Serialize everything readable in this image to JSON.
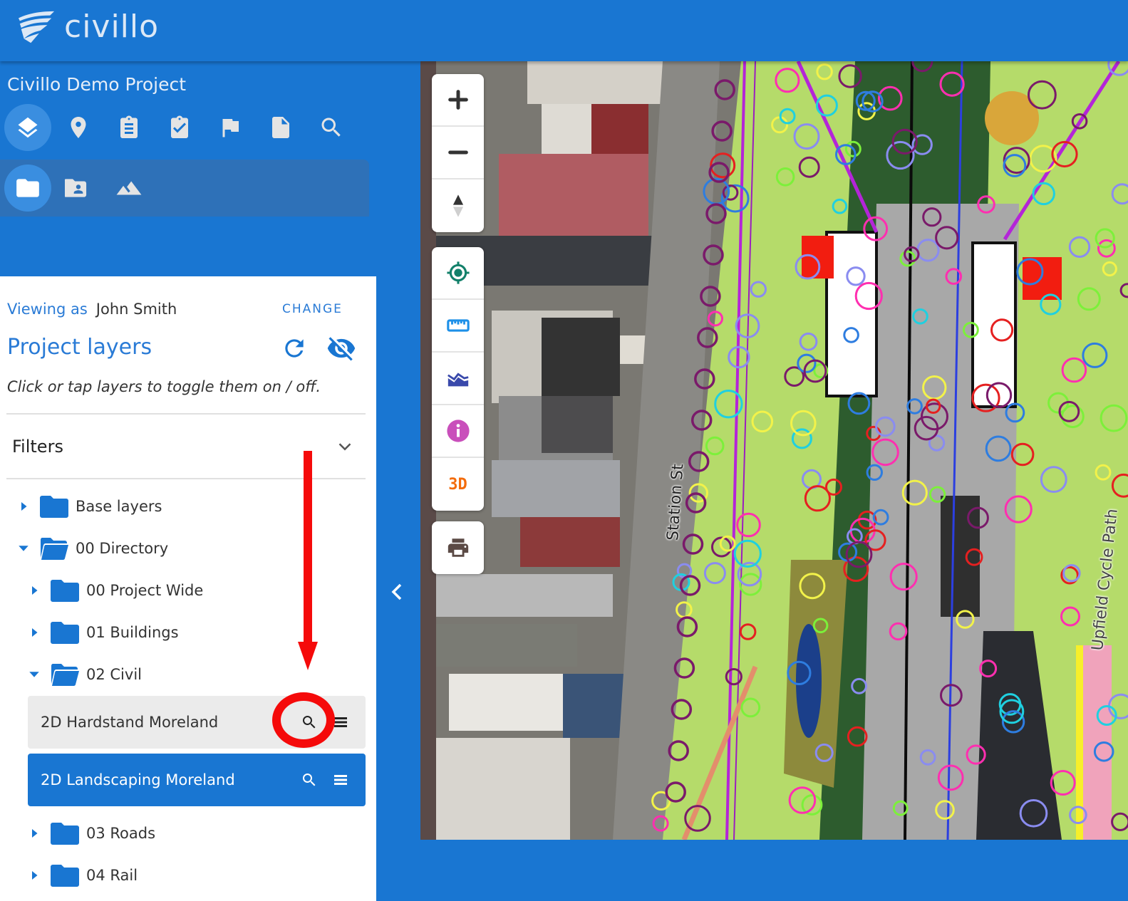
{
  "app": {
    "brand": "civillo",
    "brand_color": "#1976d2"
  },
  "sidebar": {
    "project_title": "Civillo Demo Project",
    "main_tools": [
      {
        "icon": "layers-icon",
        "label": "Layers",
        "active": true
      },
      {
        "icon": "location-pin-icon",
        "label": "Locations",
        "active": false
      },
      {
        "icon": "clipboard-list-icon",
        "label": "Forms",
        "active": false
      },
      {
        "icon": "clipboard-check-icon",
        "label": "Tasks",
        "active": false
      },
      {
        "icon": "flag-icon",
        "label": "Issues",
        "active": false
      },
      {
        "icon": "document-icon",
        "label": "Documents",
        "active": false
      },
      {
        "icon": "search-icon",
        "label": "Search",
        "active": false
      }
    ],
    "sub_tools": [
      {
        "icon": "folder-icon",
        "label": "Project layers",
        "active": true
      },
      {
        "icon": "folder-account-icon",
        "label": "User layers",
        "active": false
      },
      {
        "icon": "terrain-icon",
        "label": "Terrain",
        "active": false
      }
    ]
  },
  "panel": {
    "viewing_as_label": "Viewing as",
    "viewing_as_user": "John Smith",
    "change_label": "CHANGE",
    "title": "Project layers",
    "hint": "Click or tap layers to toggle them on / off.",
    "filters_label": "Filters",
    "tree": [
      {
        "label": "Base layers",
        "expanded": false,
        "level": 0
      },
      {
        "label": "00 Directory",
        "expanded": true,
        "level": 0
      },
      {
        "label": "00 Project Wide",
        "expanded": false,
        "level": 1
      },
      {
        "label": "01 Buildings",
        "expanded": false,
        "level": 1
      },
      {
        "label": "02 Civil",
        "expanded": true,
        "level": 1
      },
      {
        "label": "03 Roads",
        "expanded": false,
        "level": 1
      },
      {
        "label": "04 Rail",
        "expanded": false,
        "level": 1
      }
    ],
    "layers": [
      {
        "label": "2D Hardstand Moreland",
        "visible": false
      },
      {
        "label": "2D Landscaping Moreland",
        "visible": true
      }
    ]
  },
  "map": {
    "controls": {
      "zoom_in": "zoom-in",
      "zoom_out": "zoom-out",
      "compass": "reset-north",
      "locate": "my-location",
      "measure": "measure",
      "profile": "elevation-profile",
      "info": "feature-info",
      "three_d_label": "3D",
      "print": "print"
    },
    "street_labels": {
      "station_st": "Station St",
      "cycle_path": "Upfield Cycle Path"
    }
  },
  "annotation": {
    "color": "#f50a0a",
    "target": "2D Landscaping Moreland zoom-to-layer button"
  }
}
